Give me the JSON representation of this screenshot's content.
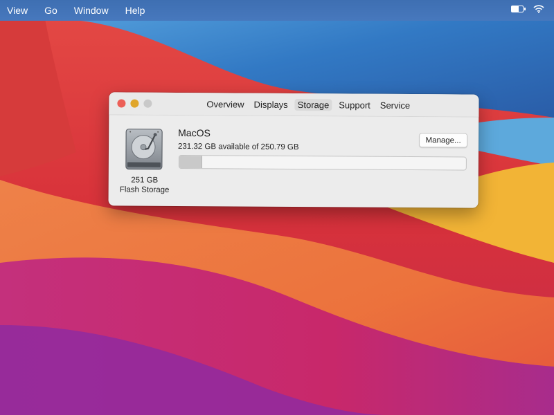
{
  "menubar": {
    "items": [
      "View",
      "Go",
      "Window",
      "Help"
    ],
    "status_icons": [
      "battery-icon",
      "wifi-icon"
    ]
  },
  "window": {
    "traffic_lights": {
      "close": "#ec5f57",
      "minimize": "#e0a62b",
      "zoom": "#c9c9c9"
    },
    "tabs": [
      "Overview",
      "Displays",
      "Storage",
      "Support",
      "Service"
    ],
    "active_tab": "Storage"
  },
  "storage": {
    "drive": {
      "icon": "hard-drive-icon",
      "size": "251 GB",
      "type": "Flash Storage"
    },
    "volume": {
      "name": "MacOS",
      "availability": "231.32 GB available of 250.79 GB",
      "used_fraction": 0.078
    },
    "manage_label": "Manage..."
  },
  "colors": {
    "menubar": "#4576bb",
    "window_bg": "#ececec",
    "wallpaper_red": "#d9343c",
    "wallpaper_orange": "#f0883a",
    "wallpaper_blue": "#3c86c9"
  }
}
